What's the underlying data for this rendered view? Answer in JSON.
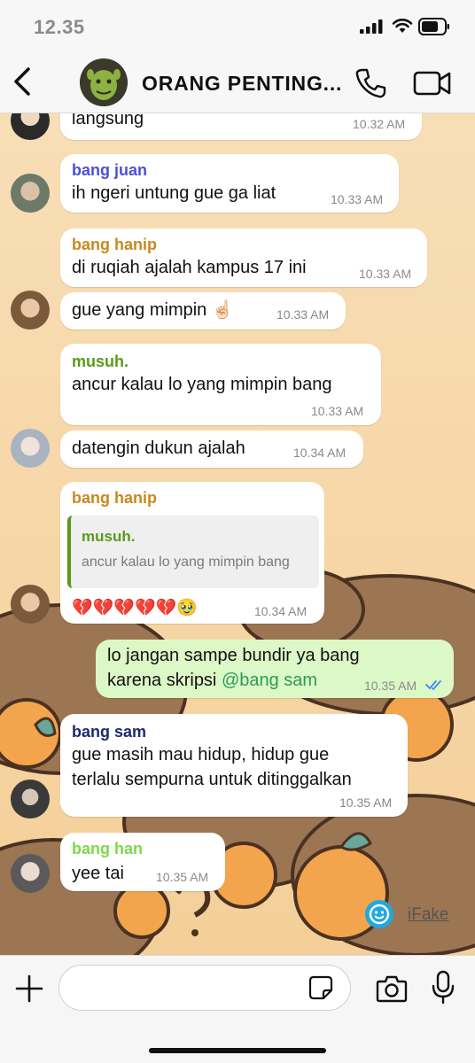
{
  "status_bar": {
    "time": "12.35"
  },
  "header": {
    "title": "ORANG PENTING..."
  },
  "messages": [
    {
      "text": "langsung",
      "time": "10.32 AM"
    },
    {
      "sender": "bang juan",
      "sender_color": "#4a4fd8",
      "text": "ih ngeri untung gue ga liat",
      "time": "10.33 AM"
    },
    {
      "sender": "bang hanip",
      "sender_color": "#c8891e",
      "text": "di ruqiah ajalah kampus 17 ini",
      "time": "10.33 AM"
    },
    {
      "text": "gue yang mimpin ☝🏻",
      "time": "10.33 AM"
    },
    {
      "sender": "musuh.",
      "sender_color": "#5a9a1a",
      "text": "ancur kalau lo yang mimpin bang",
      "time": "10.33 AM"
    },
    {
      "text": "datengin dukun ajalah",
      "time": "10.34 AM"
    },
    {
      "sender": "bang hanip",
      "sender_color": "#c8891e",
      "quote": {
        "sender": "musuh.",
        "text": "ancur kalau lo yang mimpin bang"
      },
      "emoji": "💔💔💔💔💔🥹",
      "time": "10.34 AM"
    },
    {
      "outgoing": true,
      "line1": "lo jangan sampe bundir ya bang",
      "line2_prefix": "karena skripsi ",
      "mention": "@bang sam",
      "time": "10.35 AM"
    },
    {
      "sender": "bang sam",
      "sender_color": "#1d2a6e",
      "line1": "gue masih mau hidup, hidup gue",
      "line2": "terlalu sempurna untuk ditinggalkan",
      "time": "10.35 AM"
    },
    {
      "sender": "bang han",
      "sender_color": "#7dd94a",
      "text": "yee tai",
      "time": "10.35 AM"
    }
  ],
  "watermark": {
    "label": "iFake"
  },
  "composer": {
    "placeholder": ""
  },
  "colors": {
    "chat_bg": "#f6d6a6",
    "outgoing_bubble": "#dcf8c6",
    "read_ticks": "#3b8cf0"
  }
}
